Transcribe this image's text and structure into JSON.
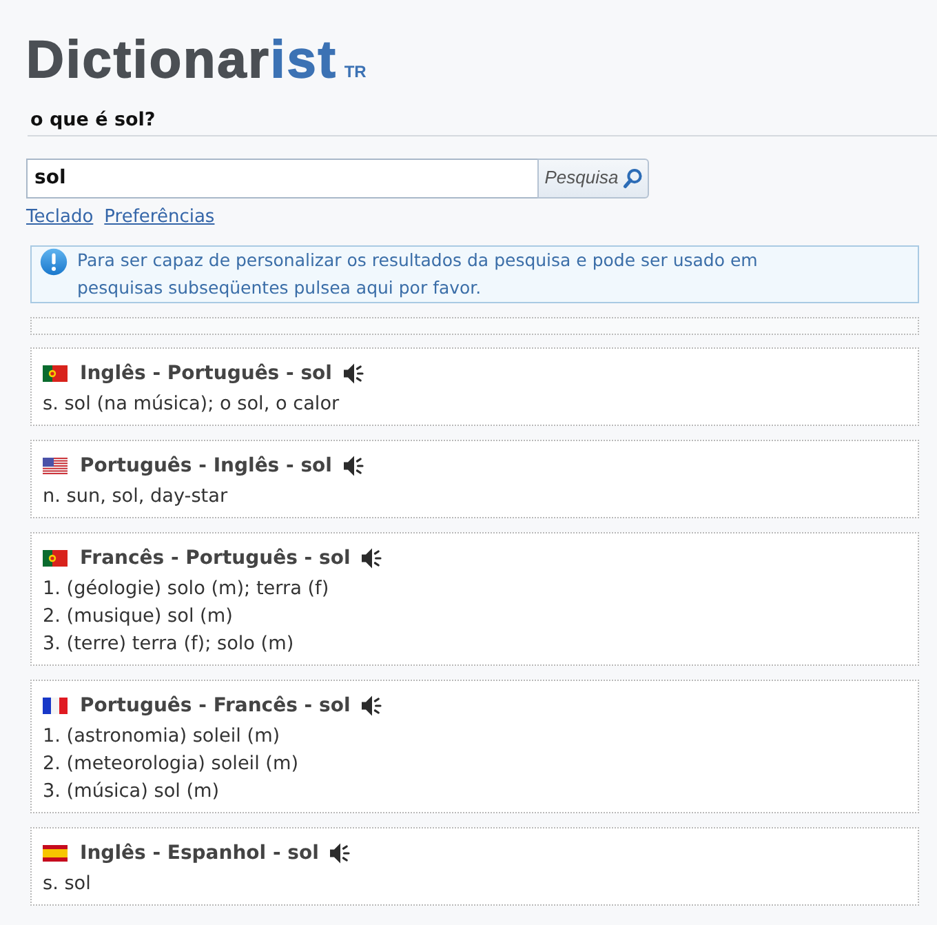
{
  "logo": {
    "text": "Dictionar",
    "accent": "ist",
    "region": "TR"
  },
  "heading": "o que é sol?",
  "search": {
    "value": "sol",
    "button": "Pesquisa"
  },
  "links": [
    "Teclado",
    "Preferências"
  ],
  "notice": "Para ser capaz de personalizar os resultados da pesquisa e pode ser usado em pesquisas subseqüentes pulsea aqui por favor.",
  "results": [
    {
      "kind": "portugal",
      "title": "Inglês - Português - sol",
      "definitions": [
        "s. sol (na música); o sol, o calor"
      ]
    },
    {
      "kind": "usa",
      "title": "Português - Inglês - sol",
      "definitions": [
        "n. sun, sol, day-star"
      ]
    },
    {
      "kind": "portugal",
      "title": "Francês - Português - sol",
      "definitions": [
        "1. (géologie) solo (m); terra (f)",
        "2. (musique) sol (m)",
        "3. (terre) terra (f); solo (m)"
      ]
    },
    {
      "kind": "france",
      "title": "Português - Francês - sol",
      "definitions": [
        "1. (astronomia) soleil (m)",
        "2. (meteorologia) soleil (m)",
        "3. (música) sol (m)"
      ]
    },
    {
      "kind": "spain",
      "title": "Inglês - Espanhol - sol",
      "definitions": [
        "s. sol"
      ]
    }
  ]
}
